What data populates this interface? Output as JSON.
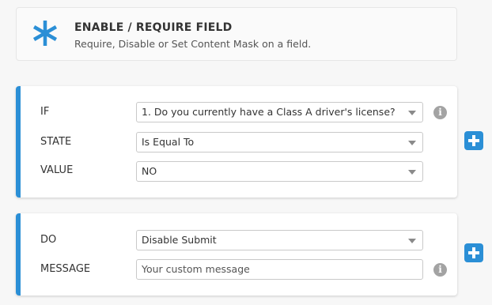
{
  "header": {
    "title": "ENABLE / REQUIRE FIELD",
    "subtitle": "Require, Disable or Set Content Mask on a field.",
    "icon": "asterisk-icon",
    "accent_color": "#2b8fd6"
  },
  "condition": {
    "if_label": "IF",
    "if_value": "1. Do you currently have a Class A driver's license?",
    "state_label": "STATE",
    "state_value": "Is Equal To",
    "value_label": "VALUE",
    "value_value": "NO"
  },
  "action": {
    "do_label": "DO",
    "do_value": "Disable Submit",
    "message_label": "MESSAGE",
    "message_placeholder": "Your custom message"
  },
  "icons": {
    "info": "info-icon",
    "add": "plus-icon",
    "dropdown": "chevron-down-icon"
  }
}
